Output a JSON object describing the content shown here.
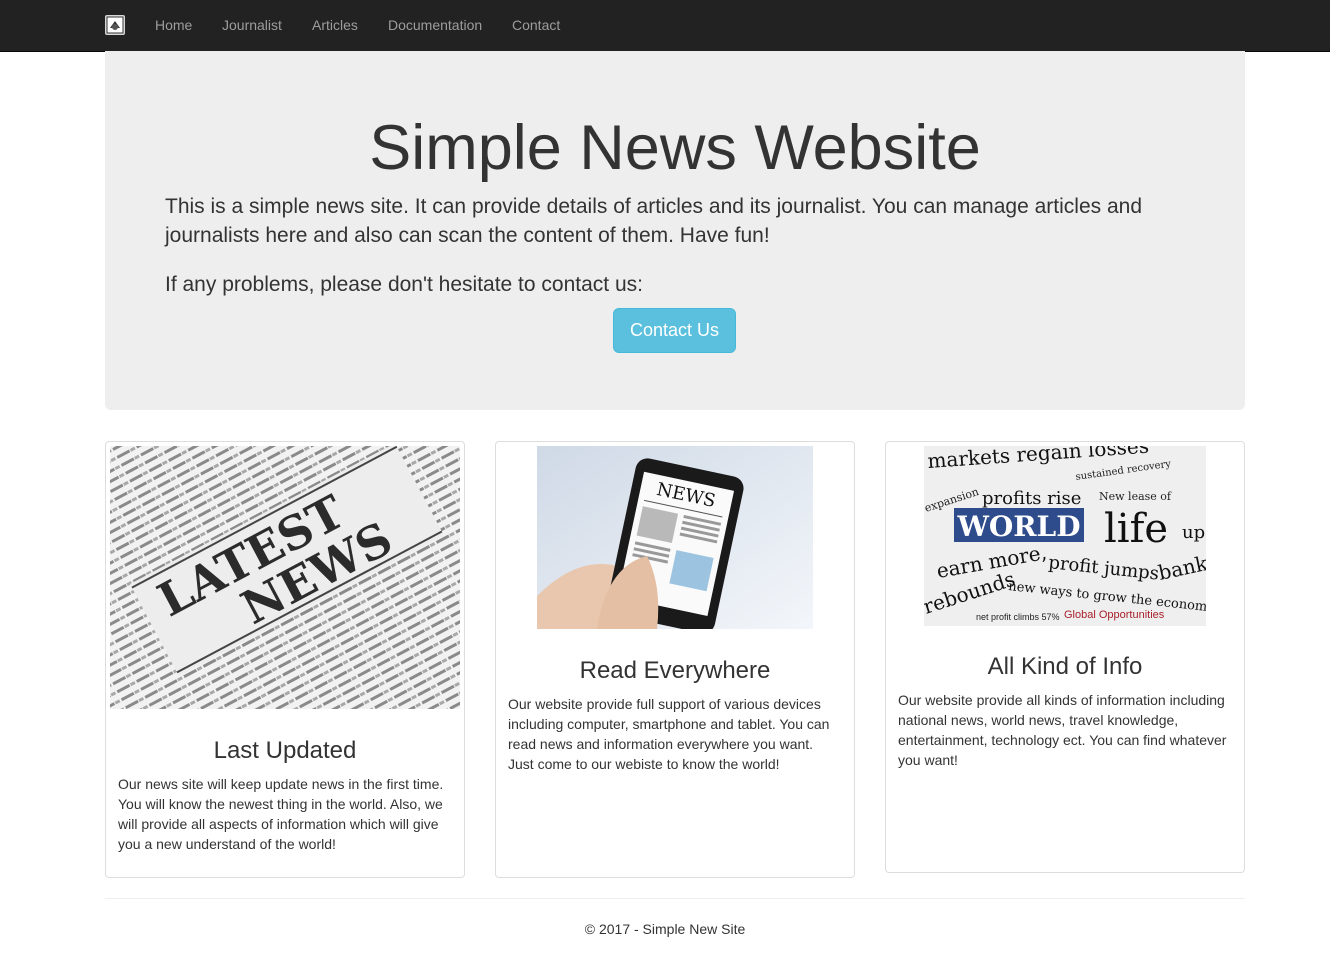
{
  "nav": {
    "brand_icon": "site-logo-icon",
    "items": [
      {
        "label": "Home"
      },
      {
        "label": "Journalist"
      },
      {
        "label": "Articles"
      },
      {
        "label": "Documentation"
      },
      {
        "label": "Contact"
      }
    ]
  },
  "jumbotron": {
    "title": "Simple News Website",
    "intro": "This is a simple news site. It can provide details of articles and its journalist. You can manage articles and journalists here and also can scan the content of them. Have fun!",
    "problems": "If any problems, please don't hesitate to contact us:",
    "contact_button": "Contact Us"
  },
  "cards": [
    {
      "image_text_1": "LATEST",
      "image_text_2": "NEWS",
      "title": "Last Updated",
      "text": "Our news site will keep update news in the first time. You will know the newest thing in the world. Also, we will provide all aspects of information which will give you a new understand of the world!"
    },
    {
      "image_text": "NEWS",
      "title": "Read Everywhere",
      "text": "Our website provide full support of various devices including computer, smartphone and tablet. You can read news and information everywhere you want. Just come to our webiste to know the world!"
    },
    {
      "image_words": [
        "markets regain losses",
        "sustained recovery",
        "expansion",
        "profits rise",
        "New lease of",
        "WORLD",
        "life",
        "up",
        "earn more,",
        "profit jumps",
        "banki",
        "rebounds",
        "new ways to grow the economy",
        "net profit climbs 57%",
        "Global Opportunities"
      ],
      "title": "All Kind of Info",
      "text": "Our website provide all kinds of information including national news, world news, travel knowledge, entertainment, technology ect. You can find whatever you want!"
    }
  ],
  "footer": {
    "text": "© 2017 - Simple New Site"
  },
  "colors": {
    "navbar": "#222222",
    "nav_link": "#9d9d9d",
    "jumbotron": "#eeeeee",
    "info_button": "#5bc0de"
  }
}
